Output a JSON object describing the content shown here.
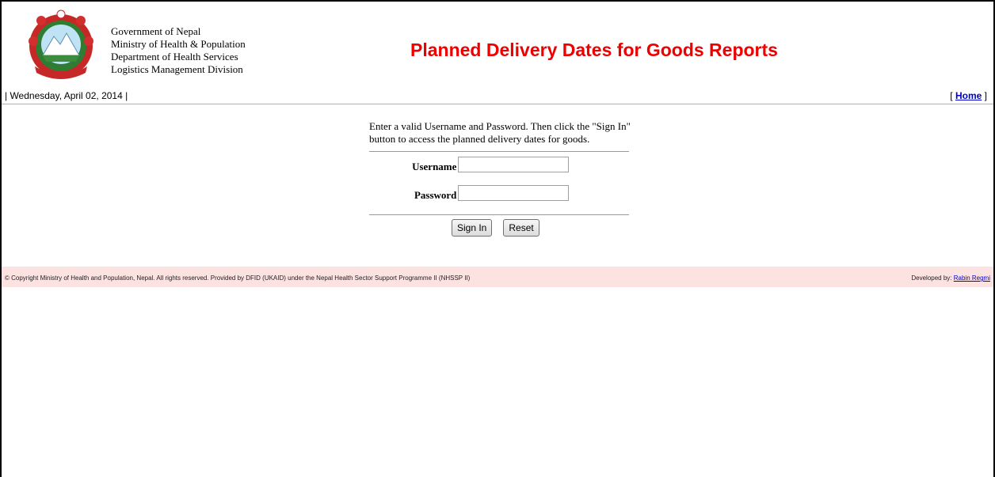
{
  "header": {
    "gov_lines": [
      "Government of Nepal",
      "Ministry of Health & Population",
      "Department of Health Services",
      "Logistics Management Division"
    ],
    "title": "Planned Delivery Dates for Goods Reports"
  },
  "nav": {
    "date": "| Wednesday, April 02, 2014 |",
    "home_open": "[",
    "home_label": "Home",
    "home_close": "]"
  },
  "login": {
    "instructions": "Enter a valid Username and Password. Then click the \"Sign In\" button to access the planned delivery dates for goods.",
    "username_label": "Username :",
    "username_value": "",
    "password_label": "Password :",
    "password_value": "",
    "sign_in_label": "Sign In",
    "reset_label": "Reset"
  },
  "footer": {
    "copyright": "© Copyright Ministry of Health and Population, Nepal. All rights reserved. Provided by DFID (UKAID) under the Nepal Health Sector Support Programme II (NHSSP II)",
    "developed_by": "Developed by:",
    "developer_name": "Rabin Regmi"
  },
  "colors": {
    "title_red": "#ee0000",
    "footer_bg": "#fde2e2",
    "link_blue": "#0000cc"
  },
  "icons": {
    "emblem": "nepal-government-emblem"
  }
}
